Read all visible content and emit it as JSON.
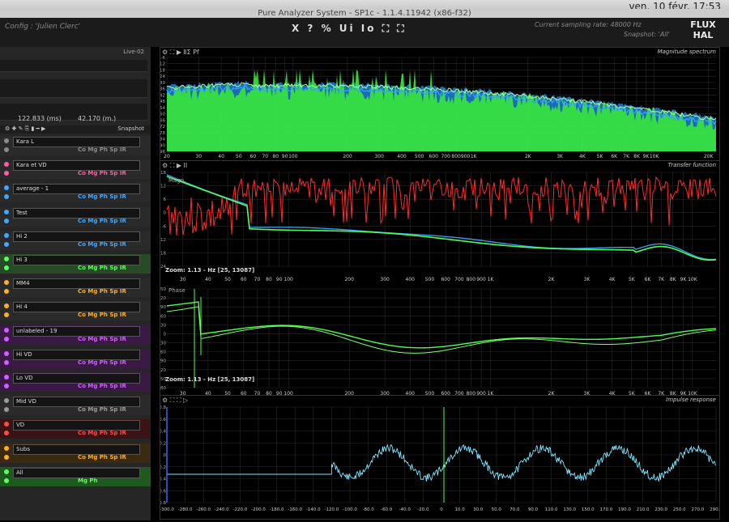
{
  "menubar": {
    "clock": "ven. 10 févr.  17:53"
  },
  "window": {
    "title": "Pure Analyzer System - SP1c - 1.1.4.11942 (x86-f32)"
  },
  "header": {
    "config": "Config : 'Julien Clerc'",
    "toolbar": "X ? % Ui Io ⛶ ⛶",
    "sampling_rate": "Current sampling rate: 48000 Hz",
    "snapshot": "Snapshot: 'All'",
    "logo_top": "FLUX",
    "logo_bottom": "HAL"
  },
  "left_panel": {
    "live_label": "Live-02",
    "delay_ms": "122.833 (ms)",
    "distance_m": "42.170 (m.)",
    "snapshot_label": "Snapshot",
    "channels": [
      {
        "name": "Kara L",
        "tags": "Co Mg Ph Sp IR",
        "color": "#8a8a8a",
        "bg": "#2a2a2a"
      },
      {
        "name": "Kara et VD",
        "tags": "Co Mg Ph Sp IR",
        "color": "#ff5fa0",
        "bg": "#2a2a2a"
      },
      {
        "name": "average - 1",
        "tags": "Co Mg Ph Sp IR",
        "color": "#3fa9ff",
        "bg": "#2a2a2a"
      },
      {
        "name": "Test",
        "tags": "Co Mg Ph Sp IR",
        "color": "#3fa9ff",
        "bg": "#2a2a2a"
      },
      {
        "name": "Hi 2",
        "tags": "Co Mg Ph Sp IR",
        "color": "#3fa9ff",
        "bg": "#2a2a2a"
      },
      {
        "name": "Hi 3",
        "tags": "Co Mg Ph Sp IR",
        "color": "#5cff5c",
        "bg": "#274a27"
      },
      {
        "name": "MM4",
        "tags": "Co Mg Ph Sp IR",
        "color": "#ffb020",
        "bg": "#2a2a2a"
      },
      {
        "name": "Hi 4",
        "tags": "Co Mg Ph Sp IR",
        "color": "#ffb020",
        "bg": "#2a2a2a"
      },
      {
        "name": "unlabeled - 19",
        "tags": "Co Mg Ph Sp IR",
        "color": "#d060ff",
        "bg": "#3a1a44"
      },
      {
        "name": "Hi VD",
        "tags": "Co Mg Ph Sp IR",
        "color": "#d060ff",
        "bg": "#3a1a44"
      },
      {
        "name": "Lo VD",
        "tags": "Co Mg Ph Sp IR",
        "color": "#d060ff",
        "bg": "#3a1a44"
      },
      {
        "name": "Mid VD",
        "tags": "Co Mg Ph Sp IR",
        "color": "#9a9a9a",
        "bg": "#2a2a2a"
      },
      {
        "name": "VD",
        "tags": "Co Mg Ph Sp IR",
        "color": "#ff4a4a",
        "bg": "#3a1414"
      },
      {
        "name": "Subs",
        "tags": "Co Mg Ph Sp IR",
        "color": "#ffb020",
        "bg": "#3a2a10"
      },
      {
        "name": "All",
        "tags": "Mg Ph",
        "color": "#5cff5c",
        "bg": "#1e5a1e"
      }
    ]
  },
  "spectrum": {
    "title": "Magnitude spectrum",
    "y_ticks": [
      "-6",
      "-12",
      "-18",
      "-24",
      "-30",
      "-36",
      "-42",
      "-48",
      "-54",
      "-60",
      "-66",
      "-72",
      "-78",
      "-84",
      "-90",
      "-96"
    ],
    "x_ticks": [
      "20",
      "30",
      "40",
      "50",
      "60",
      "70",
      "80",
      "90",
      "100",
      "200",
      "300",
      "400",
      "500",
      "600",
      "700",
      "800",
      "900",
      "1K",
      "2K",
      "3K",
      "4K",
      "5K",
      "6K",
      "7K",
      "8K",
      "9K",
      "10K",
      "20K"
    ]
  },
  "transfer": {
    "title": "Transfer function",
    "mag_label": "Magn.",
    "phase_label": "Phase",
    "zoom_mag": "Zoom: 1.13 - Hz [25, 13087]",
    "zoom_phase": "Zoom: 1.13 - Hz [25, 13087]",
    "y_ticks_mag": [
      "18",
      "12",
      "6",
      "0",
      "-6",
      "-12",
      "-18",
      "-24"
    ],
    "y_ticks_phase": [
      "150",
      "120",
      "90",
      "60",
      "30",
      "0",
      "-30",
      "-60",
      "-90",
      "-120",
      "-150",
      "-180"
    ],
    "x_ticks": [
      "30",
      "40",
      "50",
      "60",
      "70",
      "80",
      "90",
      "100",
      "200",
      "300",
      "400",
      "500",
      "600",
      "700",
      "800",
      "900",
      "1K",
      "2K",
      "3K",
      "4K",
      "5K",
      "6K",
      "7K",
      "8K",
      "9K",
      "10K"
    ]
  },
  "impulse": {
    "title": "Impulse response",
    "y_ticks": [
      "0.8",
      "0.6",
      "0.4",
      "0.2",
      "0",
      "-0.2",
      "-0.4",
      "-0.6",
      "-0.8"
    ],
    "x_ticks": [
      "-300.0",
      "-280.0",
      "-260.0",
      "-240.0",
      "-220.0",
      "-200.0",
      "-180.0",
      "-160.0",
      "-140.0",
      "-120.0",
      "-100.0",
      "-80.0",
      "-60.0",
      "-40.0",
      "-20.0",
      "0",
      "10.0",
      "30.0",
      "50.0",
      "70.0",
      "90.0",
      "110.0",
      "130.0",
      "150.0",
      "170.0",
      "190.0",
      "210.0",
      "230.0",
      "250.0",
      "270.0",
      "290.0"
    ]
  },
  "colors": {
    "green": "#4dff4d",
    "blue": "#3aa0ff",
    "red": "#ff2a2a",
    "impulse": "#7fe3ff",
    "grid": "#2a2a2a"
  }
}
